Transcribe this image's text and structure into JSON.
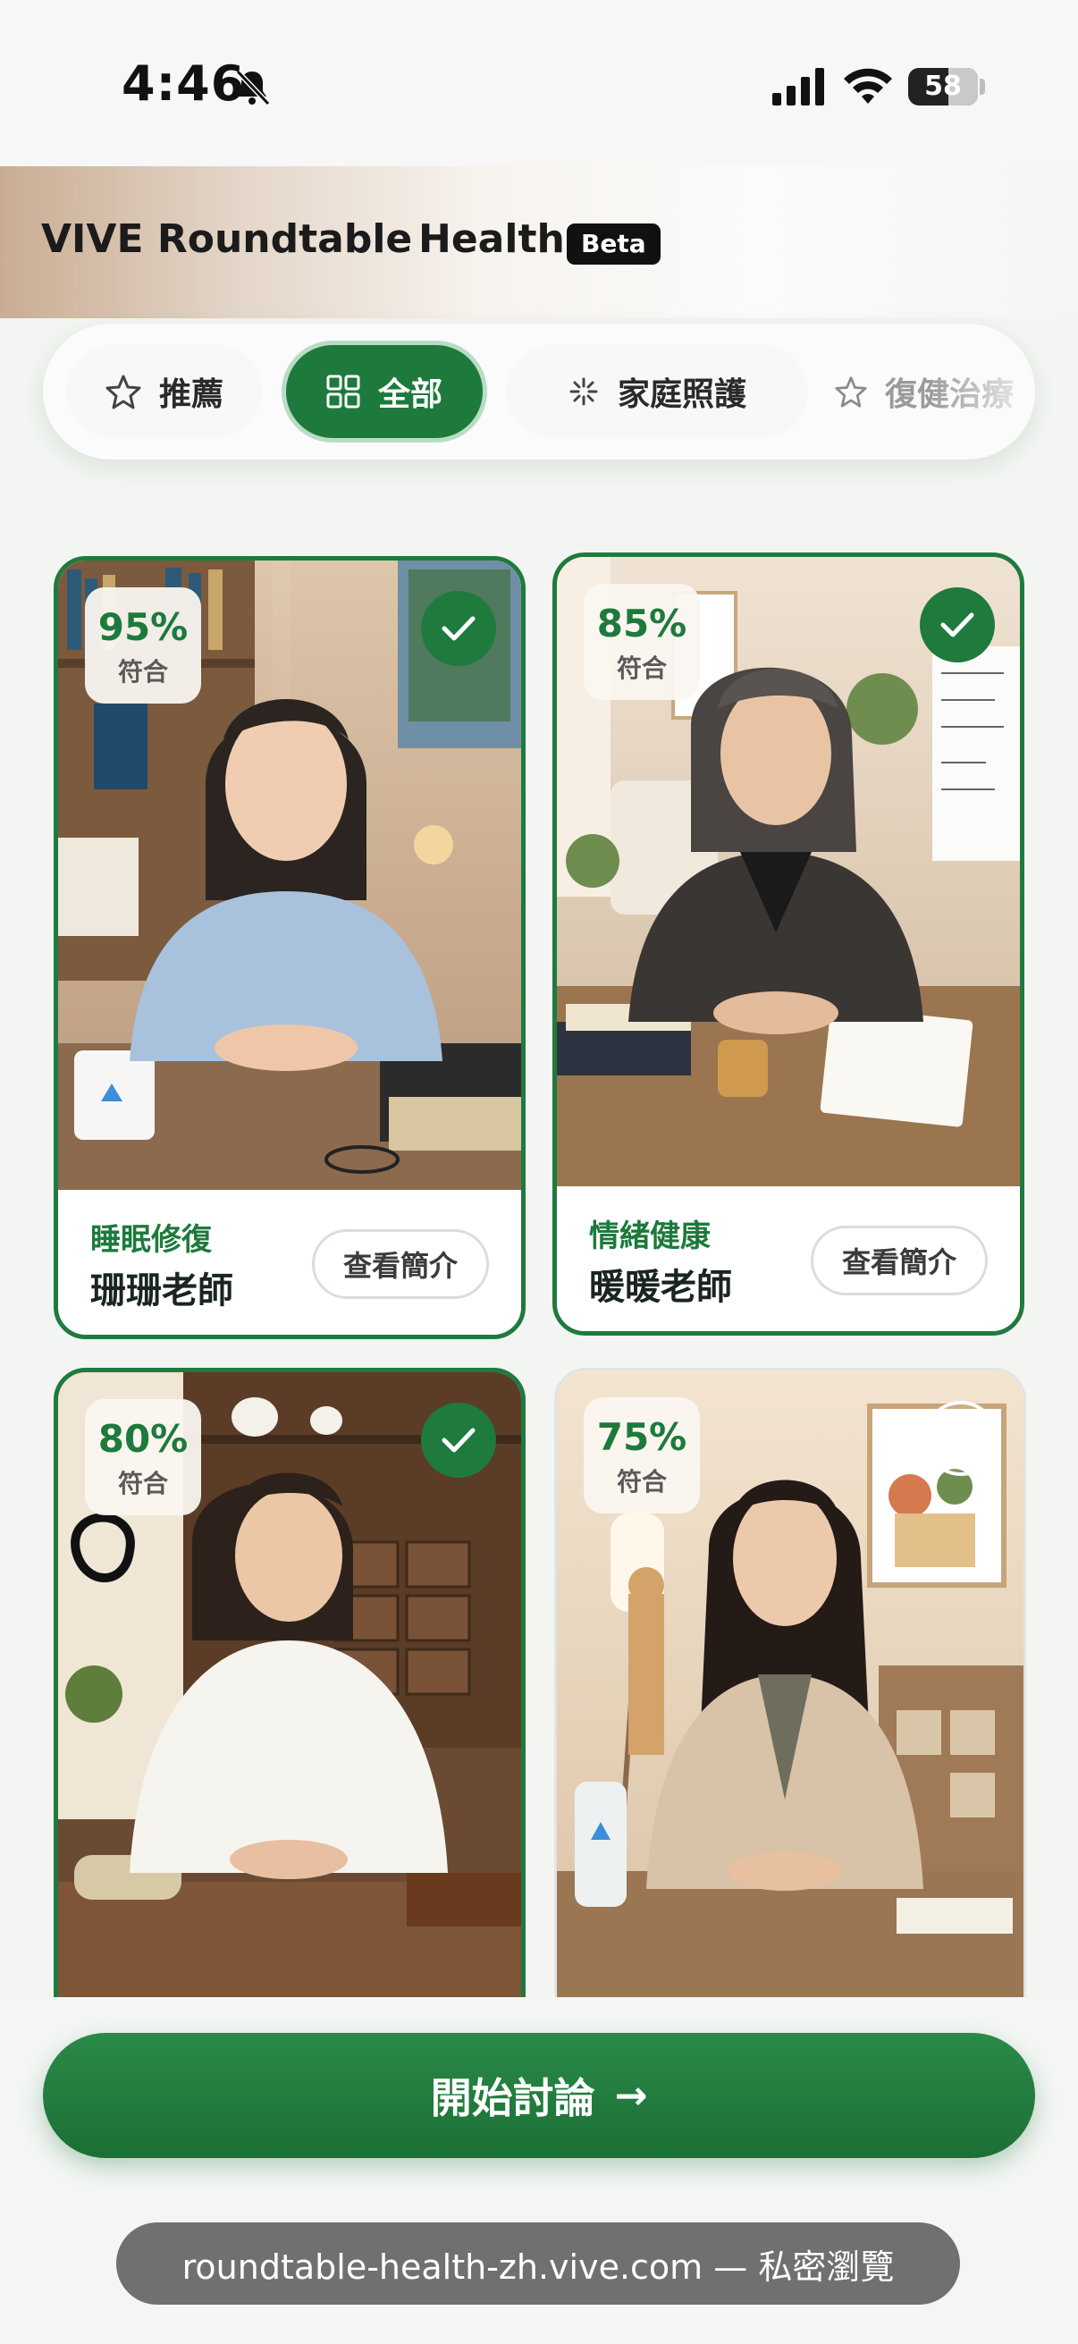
{
  "status_bar": {
    "time": "4:46",
    "battery": "58",
    "battery_level": 0.58
  },
  "header": {
    "title": "VIVE Roundtable",
    "subtitle": "Health",
    "badge": "Beta"
  },
  "tabs": [
    {
      "label": "推薦",
      "icon": "star-icon",
      "active": false
    },
    {
      "label": "全部",
      "icon": "grid-icon",
      "active": true
    },
    {
      "label": "家庭照護",
      "icon": "sparkle-icon",
      "active": false
    },
    {
      "label": "復健治療",
      "icon": "star-icon",
      "active": false
    }
  ],
  "cards": [
    {
      "match": "95%",
      "match_label": "符合",
      "specialty": "睡眠修復",
      "name": "珊珊老師",
      "button": "查看簡介",
      "selected": true
    },
    {
      "match": "85%",
      "match_label": "符合",
      "specialty": "情緒健康",
      "name": "暖暖老師",
      "button": "查看簡介",
      "selected": true
    },
    {
      "match": "80%",
      "match_label": "符合",
      "specialty": "",
      "name": "",
      "button": "",
      "selected": true
    },
    {
      "match": "75%",
      "match_label": "符合",
      "specialty": "",
      "name": "",
      "button": "",
      "selected": false
    }
  ],
  "cta": {
    "label": "開始討論",
    "arrow": "→"
  },
  "browser": {
    "url_text": "roundtable-health-zh.vive.com — 私密瀏覽"
  },
  "colors": {
    "accent": "#1d7a3c",
    "background": "#f2f5f1"
  }
}
